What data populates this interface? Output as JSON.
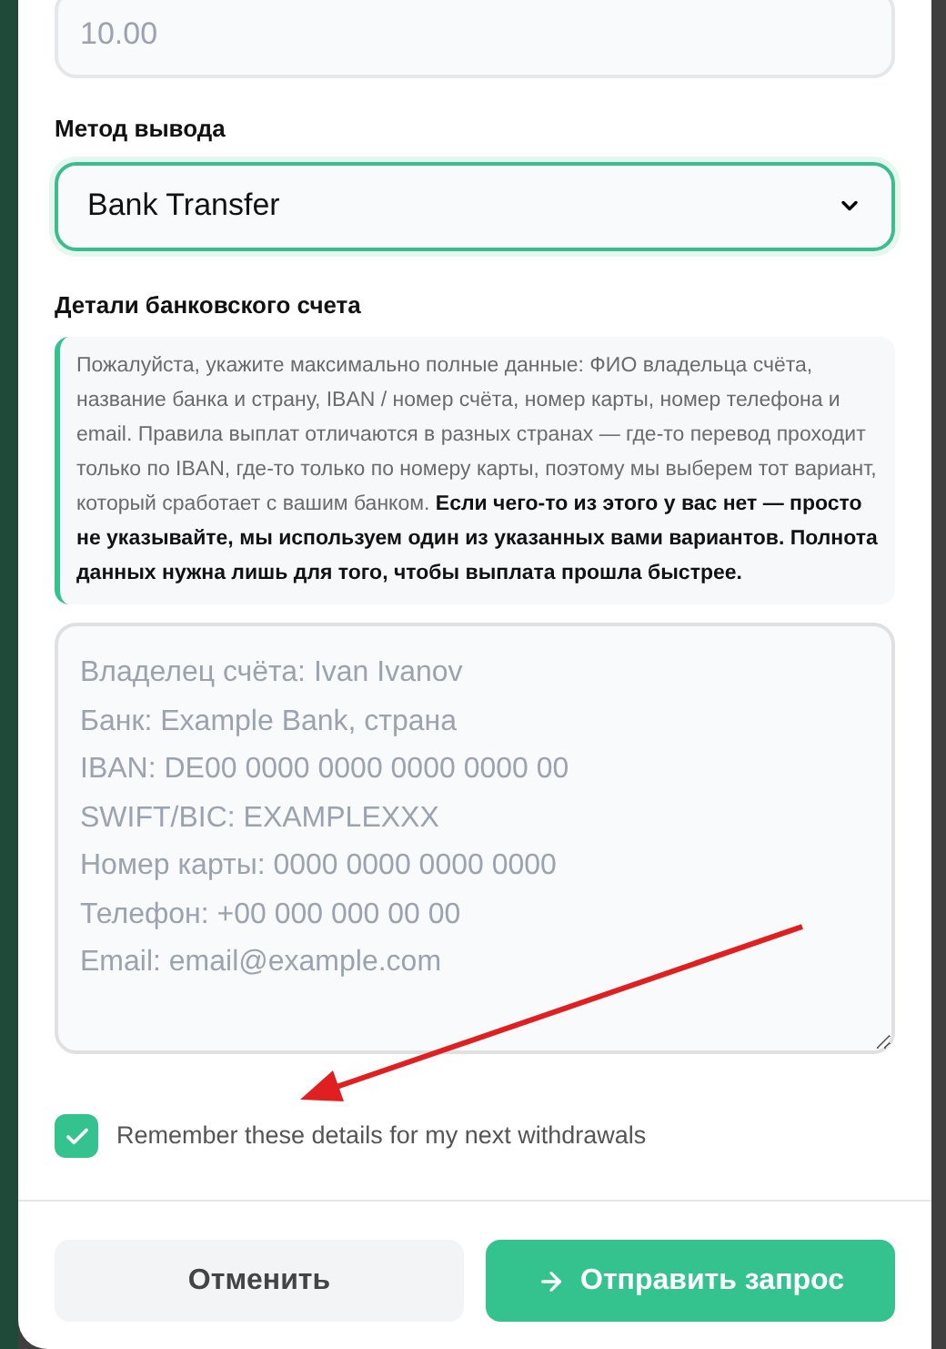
{
  "amount_field": {
    "placeholder": "10.00"
  },
  "withdrawal_method": {
    "label": "Метод вывода",
    "value": "Bank Transfer"
  },
  "bank_details": {
    "label": "Детали банковского счета",
    "note": "Пожалуйста, укажите максимально полные данные: ФИО владельца счёта, название банка и страну, IBAN / номер счёта, номер карты, номер телефона и email. Правила выплат отличаются в разных странах — где-то перевод проходит только по IBAN, где-то только по номеру карты, поэтому мы выберем тот вариант, который сработает с вашим банком. **Если чего-то из этого у вас нет — просто не указывайте, мы используем один из указанных вами вариантов. Полнота данных нужна лишь для того, чтобы выплата прошла быстрее.**",
    "placeholder": "Владелец счёта: Ivan Ivanov\nБанк: Example Bank, страна\nIBAN: DE00 0000 0000 0000 0000 00\nSWIFT/BIC: EXAMPLEXXX\nНомер карты: 0000 0000 0000 0000\nТелефон: +00 000 000 00 00\nEmail: email@example.com"
  },
  "remember": {
    "label": "Remember these details for my next withdrawals",
    "checked": true
  },
  "buttons": [
    {
      "kind": "secondary",
      "label": "Отменить"
    },
    {
      "kind": "primary",
      "label": "Отправить запрос"
    }
  ],
  "annotation": {
    "arrow": true
  }
}
